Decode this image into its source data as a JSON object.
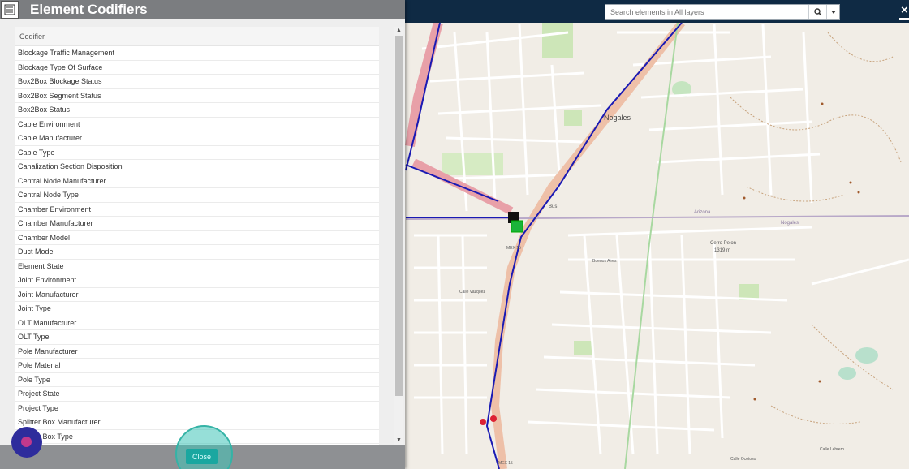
{
  "map": {
    "labels": {
      "nogales": "Nogales",
      "cerro_pelon": "Cerro Pelon",
      "elevation": "1319 m",
      "arizona": "Arizona",
      "nogales_small": "Nogales",
      "bus": "Bus",
      "mex15": "MEX 15",
      "mex15_bottom": "MEX 15",
      "calle_ocotoso": "Calle Ocotoso",
      "buenos_aires": "Buenos Aires",
      "calle_vazquez": "Calle Vazquez",
      "calle_lebrero": "Calle Lebrero"
    }
  },
  "search": {
    "placeholder": "Search elements in All layers"
  },
  "dialog": {
    "title": "Element Codifiers",
    "column_header": "Codifier",
    "close_label": "Close",
    "items": [
      "Blockage Traffic Management",
      "Blockage Type Of Surface",
      "Box2Box Blockage Status",
      "Box2Box Segment Status",
      "Box2Box Status",
      "Cable Environment",
      "Cable Manufacturer",
      "Cable Type",
      "Canalization Section Disposition",
      "Central Node Manufacturer",
      "Central Node Type",
      "Chamber Environment",
      "Chamber Manufacturer",
      "Chamber Model",
      "Duct Model",
      "Element State",
      "Joint Environment",
      "Joint Manufacturer",
      "Joint Type",
      "OLT Manufacturer",
      "OLT Type",
      "Pole Manufacturer",
      "Pole Material",
      "Pole Type",
      "Project State",
      "Project Type",
      "Splitter Box Manufacturer",
      "Splitter Box Type"
    ]
  },
  "colors": {
    "topbar": "#0f2a44",
    "dialog_header": "#7b7d80",
    "accent": "#1aa7a0",
    "fiber_line": "#1a1ab4"
  }
}
